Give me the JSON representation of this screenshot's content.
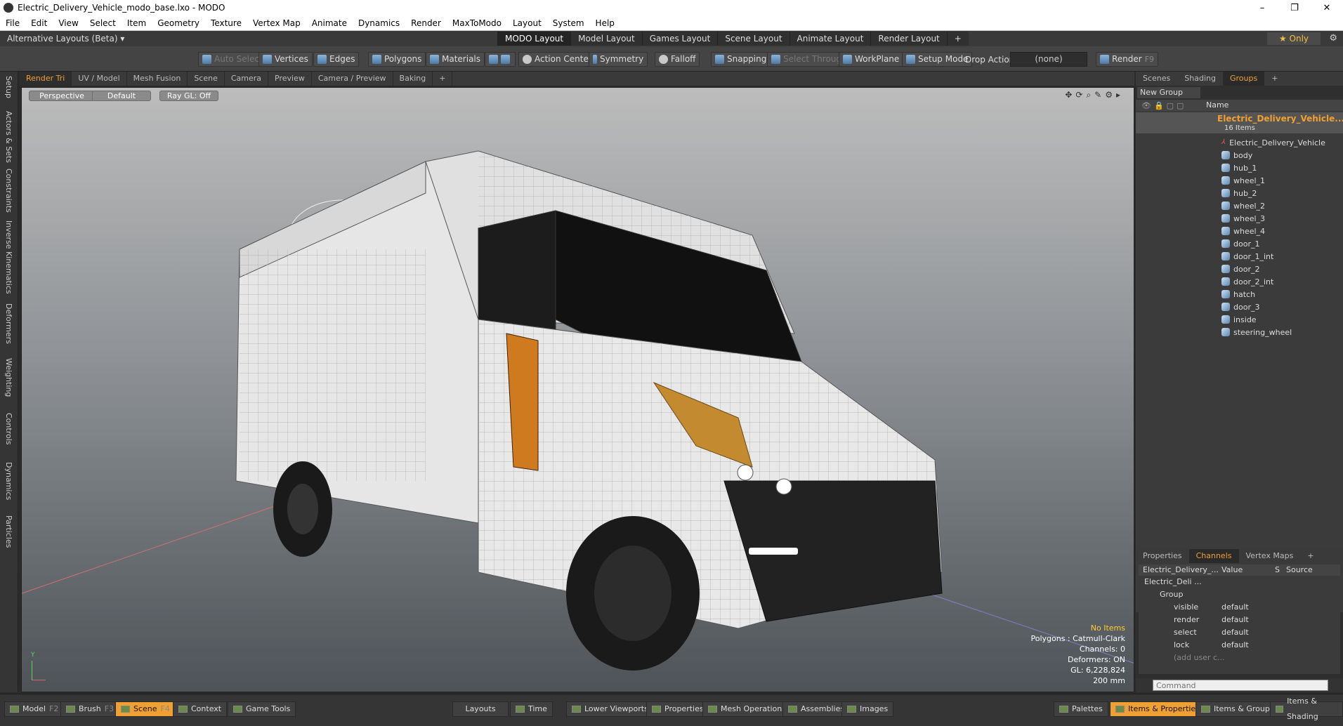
{
  "window": {
    "title": "Electric_Delivery_Vehicle_modo_base.lxo - MODO",
    "controls": [
      "–",
      "❐",
      "✕"
    ]
  },
  "menu": [
    "File",
    "Edit",
    "View",
    "Select",
    "Item",
    "Geometry",
    "Texture",
    "Vertex Map",
    "Animate",
    "Dynamics",
    "Render",
    "MaxToModo",
    "Layout",
    "System",
    "Help"
  ],
  "layout_bar": {
    "alt_layouts": "Alternative Layouts (Beta) ▾",
    "tabs": [
      "MODO Layout",
      "Model Layout",
      "Games Layout",
      "Scene Layout",
      "Animate Layout",
      "Render Layout"
    ],
    "add": "+",
    "only": "★ Only"
  },
  "toolbar": {
    "auto_select": "Auto Select",
    "vertices": "Vertices",
    "edges": "Edges",
    "polygons": "Polygons",
    "materials": "Materials",
    "action_center": "Action Center",
    "symmetry": "Symmetry",
    "falloff": "Falloff",
    "snapping": "Snapping",
    "select_through": "Select Through",
    "workplane": "WorkPlane",
    "setup_mode": "Setup Mode",
    "drop_action": "Drop Action",
    "drop_value": "(none)",
    "render": "Render",
    "render_key": "F9"
  },
  "side_tabs": [
    "Setup",
    "Actors & Sets",
    "Constraints",
    "Inverse Kinematics",
    "Deformers",
    "Weighting",
    "Controls",
    "Dynamics",
    "Particles"
  ],
  "viewport_tabs": [
    "Render Tri",
    "UV / Model",
    "Mesh Fusion",
    "Scene",
    "Camera",
    "Preview",
    "Camera / Preview",
    "Baking",
    "+"
  ],
  "viewport": {
    "view": "Perspective",
    "shading": "Default",
    "raygl": "Ray GL: Off",
    "info": {
      "items": "No Items",
      "polygons": "Polygons : Catmull-Clark",
      "channels": "Channels: 0",
      "deformers": "Deformers: ON",
      "gl": "GL: 6,228,824",
      "scale": "200 mm"
    },
    "axis_label": "Y"
  },
  "right_panel": {
    "tabs": [
      "Scenes",
      "Shading",
      "Groups",
      "+"
    ],
    "new_group": "New Group",
    "name_header": "Name",
    "group_name": "Electric_Delivery_Vehicle...",
    "group_count": "16 Items",
    "items": [
      "Electric_Delivery_Vehicle",
      "body",
      "hub_1",
      "wheel_1",
      "hub_2",
      "wheel_2",
      "wheel_3",
      "wheel_4",
      "door_1",
      "door_1_int",
      "door_2",
      "door_2_int",
      "hatch",
      "door_3",
      "inside",
      "steering_wheel"
    ]
  },
  "properties_panel": {
    "tabs": [
      "Properties",
      "Channels",
      "Vertex Maps",
      "+"
    ],
    "headers": [
      "Electric_Delivery_...",
      "Value",
      "S",
      "Source"
    ],
    "tree_root": "Electric_Deli ...",
    "tree_group": "Group",
    "rows": [
      {
        "name": "visible",
        "value": "default"
      },
      {
        "name": "render",
        "value": "default"
      },
      {
        "name": "select",
        "value": "default"
      },
      {
        "name": "lock",
        "value": "default"
      }
    ],
    "add_user": "(add user c..."
  },
  "command": {
    "placeholder": "Command"
  },
  "bottom_bar": {
    "left": [
      {
        "label": "Model",
        "key": "F2"
      },
      {
        "label": "Brush",
        "key": "F3"
      },
      {
        "label": "Scene",
        "key": "F4"
      },
      {
        "label": "Context",
        "key": ""
      },
      {
        "label": "Game Tools",
        "key": ""
      }
    ],
    "center": [
      "Layouts",
      "Time",
      "Lower Viewports",
      "Properties",
      "Mesh Operations",
      "Assemblies",
      "Images"
    ],
    "right": [
      "Palettes",
      "Items & Properties",
      "Items & Groups",
      "Items & Shading"
    ]
  },
  "colors": {
    "accent": "#f0a030",
    "highlight": "#ffcc33"
  }
}
